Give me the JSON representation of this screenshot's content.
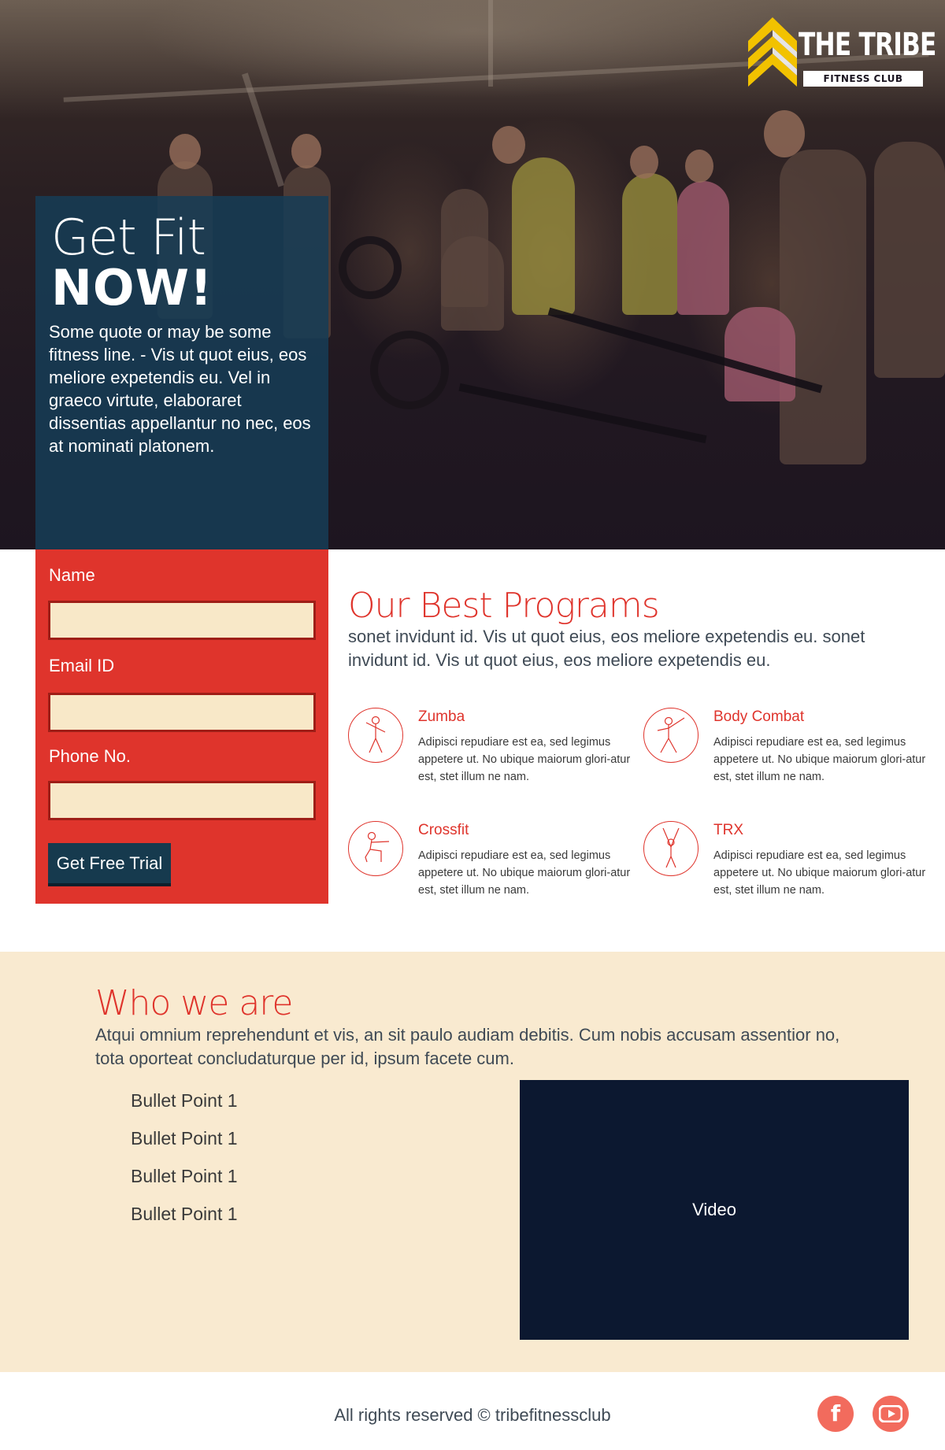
{
  "logo": {
    "title": "THE TRIBE",
    "subtitle": "FITNESS CLUB",
    "accent": "#f2c200"
  },
  "hero": {
    "title_line1": "Get Fit",
    "title_line2": "NOW!",
    "quote": "Some quote or may be some fitness line. - Vis ut quot eius, eos meliore expetendis eu. Vel in graeco virtute, elaboraret dissentias appellantur no nec, eos at nominati platonem."
  },
  "form": {
    "name_label": "Name",
    "email_label": "Email ID",
    "phone_label": "Phone No.",
    "name_value": "",
    "email_value": "",
    "phone_value": "",
    "submit_label": "Get Free Trial"
  },
  "programs": {
    "title": "Our Best Programs",
    "description": "sonet invidunt id. Vis ut quot eius, eos meliore expetendis eu. sonet invidunt id. Vis ut quot eius, eos meliore expetendis eu.",
    "items": [
      {
        "name": "Zumba",
        "icon": "zumba-icon",
        "text": "Adipisci repudiare est ea, sed legimus appetere ut. No ubique maiorum glori-atur est, stet illum ne nam."
      },
      {
        "name": "Body Combat",
        "icon": "body-combat-icon",
        "text": "Adipisci repudiare est ea, sed legimus appetere ut. No ubique maiorum glori-atur est, stet illum ne nam."
      },
      {
        "name": "Crossfit",
        "icon": "crossfit-icon",
        "text": "Adipisci repudiare est ea, sed legimus appetere ut. No ubique maiorum glori-atur est, stet illum ne nam."
      },
      {
        "name": "TRX",
        "icon": "trx-icon",
        "text": "Adipisci repudiare est ea, sed legimus appetere ut. No ubique maiorum glori-atur est, stet illum ne nam."
      }
    ]
  },
  "who": {
    "title": "Who we are",
    "description": "Atqui omnium reprehendunt et vis, an sit paulo audiam debitis. Cum nobis accusam assentior no, tota oporteat concludaturque per id, ipsum facete cum.",
    "bullets": [
      "Bullet Point 1",
      "Bullet Point 1",
      "Bullet Point 1",
      "Bullet Point 1"
    ],
    "video_label": "Video"
  },
  "footer": {
    "copyright": "All rights reserved © tribefitnessclub",
    "social": [
      {
        "icon": "facebook-icon",
        "glyph": "f"
      },
      {
        "icon": "youtube-icon"
      }
    ]
  },
  "colors": {
    "brand_red": "#df342c",
    "panel_blue": "#163c56",
    "cream": "#f9ead0",
    "video_bg": "#0c1830",
    "social": "#f26b5d"
  }
}
